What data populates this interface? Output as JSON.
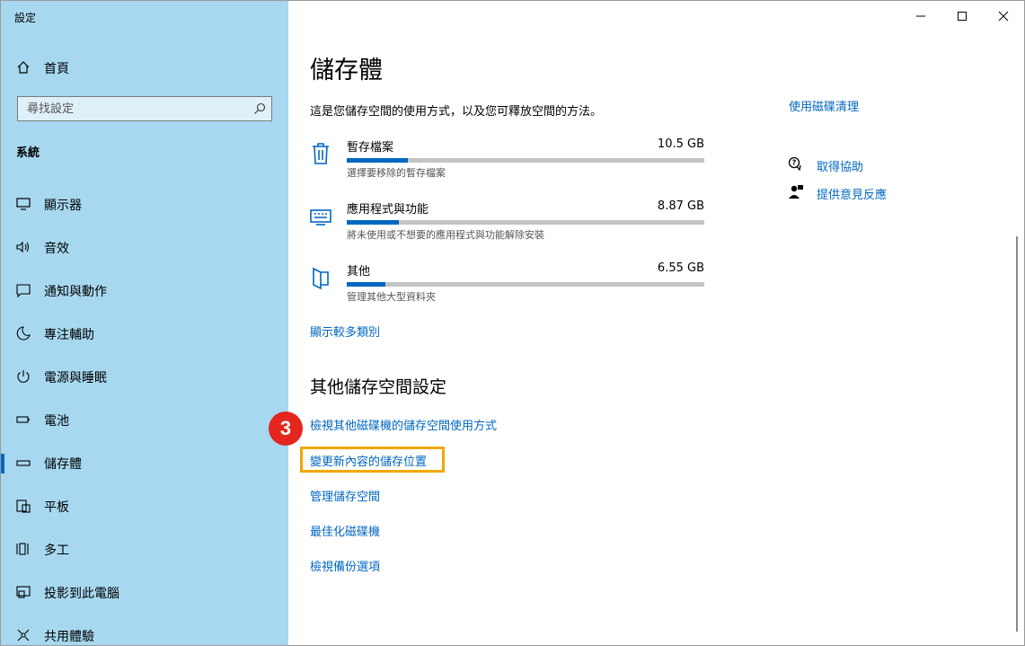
{
  "window": {
    "title": "設定",
    "controls": [
      "minimize",
      "maximize",
      "close"
    ]
  },
  "sidebar": {
    "home_label": "首頁",
    "search_placeholder": "尋找設定",
    "section_label": "系統",
    "items": [
      {
        "label": "顯示器",
        "icon": "monitor-icon"
      },
      {
        "label": "音效",
        "icon": "speaker-icon"
      },
      {
        "label": "通知與動作",
        "icon": "notification-icon"
      },
      {
        "label": "專注輔助",
        "icon": "moon-icon"
      },
      {
        "label": "電源與睡眠",
        "icon": "power-icon"
      },
      {
        "label": "電池",
        "icon": "battery-icon"
      },
      {
        "label": "儲存體",
        "icon": "storage-icon",
        "selected": true
      },
      {
        "label": "平板",
        "icon": "tablet-icon"
      },
      {
        "label": "多工",
        "icon": "multitask-icon"
      },
      {
        "label": "投影到此電腦",
        "icon": "project-icon"
      },
      {
        "label": "共用體驗",
        "icon": "share-icon"
      }
    ]
  },
  "main": {
    "title": "儲存體",
    "description": "這是您儲存空間的使用方式，以及您可釋放空間的方法。",
    "categories": [
      {
        "name": "暫存檔案",
        "size": "10.5 GB",
        "sub": "選擇要移除的暫存檔案",
        "usage_fraction": 0.17,
        "icon": "trash-icon"
      },
      {
        "name": "應用程式與功能",
        "size": "8.87 GB",
        "sub": "將未使用或不想要的應用程式與功能解除安裝",
        "usage_fraction": 0.145,
        "icon": "keyboard-icon"
      },
      {
        "name": "其他",
        "size": "6.55 GB",
        "sub": "管理其他大型資料夾",
        "usage_fraction": 0.107,
        "icon": "folder-icon"
      }
    ],
    "show_more": "顯示較多類別",
    "other_settings_title": "其他儲存空間設定",
    "other_links": [
      "檢視其他磁碟機的儲存空間使用方式",
      "變更新內容的儲存位置",
      "管理儲存空間",
      "最佳化磁碟機",
      "檢視備份選項"
    ],
    "step_badge": "3"
  },
  "right_panel": {
    "cleanup_link": "使用磁碟清理",
    "help_link": "取得協助",
    "feedback_link": "提供意見反應"
  },
  "colors": {
    "sidebar_bg": "#a7d8f0",
    "accent": "#0067c0",
    "highlight": "#f1a800",
    "badge": "#e3261e"
  }
}
